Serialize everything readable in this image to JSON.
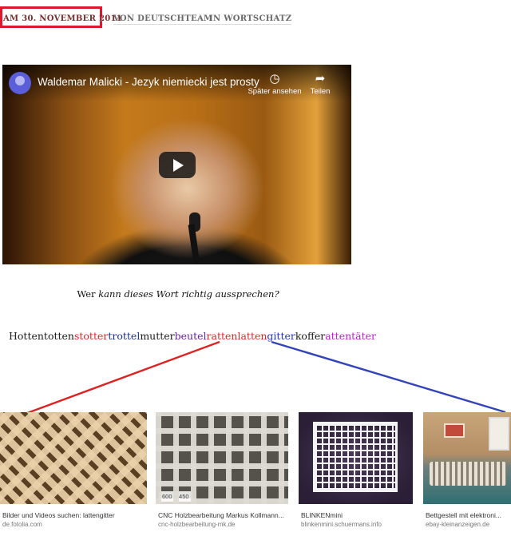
{
  "meta": {
    "date": "AM 30. NOVEMBER 2011",
    "separator": "/",
    "author": "VON DEUTSCHTEAM",
    "category": "IN WORTSCHATZ",
    "highlight_color": "#e0162b"
  },
  "video": {
    "title": "Waldemar Malicki - Jezyk niemiecki jest prosty",
    "watch_later_label": "Später ansehen",
    "share_label": "Teilen",
    "watch_later_icon": "clock-icon",
    "share_icon": "share-arrow-icon",
    "play_icon": "play-icon"
  },
  "question": {
    "before": "Wer ",
    "emphasis": "kann dieses Wort richtig aussprechen",
    "after": "?"
  },
  "compound_word": {
    "segments": [
      {
        "text": "Hottentotten",
        "color": "#1a1a1a"
      },
      {
        "text": "stotter",
        "color": "#e02424"
      },
      {
        "text": "trottel",
        "color": "#1c2f8a"
      },
      {
        "text": "mutter",
        "color": "#1a1a1a"
      },
      {
        "text": "beutel",
        "color": "#6a1fa8"
      },
      {
        "text": "ratten",
        "color": "#e02424"
      },
      {
        "text": "latten",
        "color": "#e02424"
      },
      {
        "text": "gitter",
        "color": "#2233cc"
      },
      {
        "text": "koffer",
        "color": "#1a1a1a"
      },
      {
        "text": "attentäter",
        "color": "#c21ad6"
      }
    ],
    "line_colors": {
      "left": "#dd2222",
      "right": "#3344bb"
    }
  },
  "image_results": [
    {
      "title": "Bilder und Videos suchen: lattengitter",
      "source": "de.fotolia.com"
    },
    {
      "title": "CNC Holzbearbeitung Markus Kollmann...",
      "source": "cnc-holzbearbeitung-mk.de",
      "size_badge": "600 × 450"
    },
    {
      "title": "BLINKENmini",
      "source": "blinkenmini.schuermans.info"
    },
    {
      "title": "Bettgestell mit elektroni...",
      "source": "ebay-kleinanzeigen.de"
    }
  ]
}
